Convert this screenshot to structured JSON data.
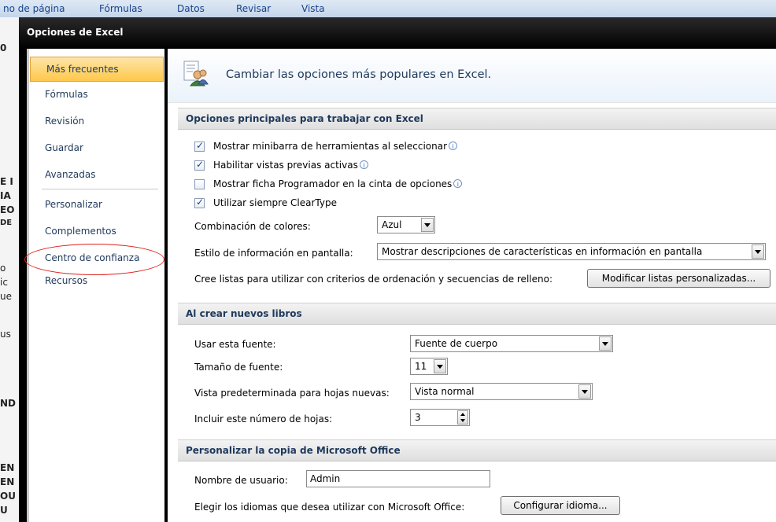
{
  "background": {
    "ribbon_tabs": [
      "no de página",
      "Fórmulas",
      "Datos",
      "Revisar",
      "Vista"
    ],
    "left_fragments": [
      "0",
      "E I",
      "IA",
      "EO",
      "DE",
      "o",
      "ic",
      "ue",
      "us",
      "ND",
      "EN",
      "EN",
      "OU",
      "U"
    ]
  },
  "dialog": {
    "title": "Opciones de Excel"
  },
  "nav": {
    "items": [
      {
        "label": "Más frecuentes"
      },
      {
        "label": "Fórmulas"
      },
      {
        "label": "Revisión"
      },
      {
        "label": "Guardar"
      },
      {
        "label": "Avanzadas"
      },
      {
        "label": "Personalizar"
      },
      {
        "label": "Complementos"
      },
      {
        "label": "Centro de confianza"
      },
      {
        "label": "Recursos"
      }
    ],
    "selected_index": 0,
    "highlighted_index": 7,
    "highlight_color": "#e0201a",
    "selected_color": "#ffc84a"
  },
  "header": {
    "text": "Cambiar las opciones más populares en Excel.",
    "icon": "options-people-icon"
  },
  "sections": {
    "main": {
      "title": "Opciones principales para trabajar con Excel",
      "checkboxes": [
        {
          "label": "Mostrar minibarra de herramientas al seleccionar",
          "checked": true,
          "info": true
        },
        {
          "label": "Habilitar vistas previas activas",
          "checked": true,
          "info": true
        },
        {
          "label": "Mostrar ficha Programador en la cinta de opciones",
          "checked": false,
          "info": true
        },
        {
          "label": "Utilizar siempre ClearType",
          "checked": true,
          "info": false
        }
      ],
      "color_scheme_label": "Combinación de colores:",
      "color_scheme_value": "Azul",
      "screentip_label": "Estilo de información en pantalla:",
      "screentip_value": "Mostrar descripciones de características en información en pantalla",
      "lists_label": "Cree listas para utilizar con criterios de ordenación y secuencias de relleno:",
      "lists_button": "Modificar listas personalizadas..."
    },
    "new_books": {
      "title": "Al crear nuevos libros",
      "font_label": "Usar esta fuente:",
      "font_value": "Fuente de cuerpo",
      "size_label": "Tamaño de fuente:",
      "size_value": "11",
      "view_label": "Vista predeterminada para hojas nuevas:",
      "view_value": "Vista normal",
      "sheets_label": "Incluir este número de hojas:",
      "sheets_value": "3"
    },
    "office": {
      "title": "Personalizar la copia de Microsoft Office",
      "user_label": "Nombre de usuario:",
      "user_value": "Admin",
      "lang_label": "Elegir los idiomas que desea utilizar con Microsoft Office:",
      "lang_button": "Configurar idioma..."
    }
  },
  "info_glyph": "i",
  "check_glyph": "✓"
}
